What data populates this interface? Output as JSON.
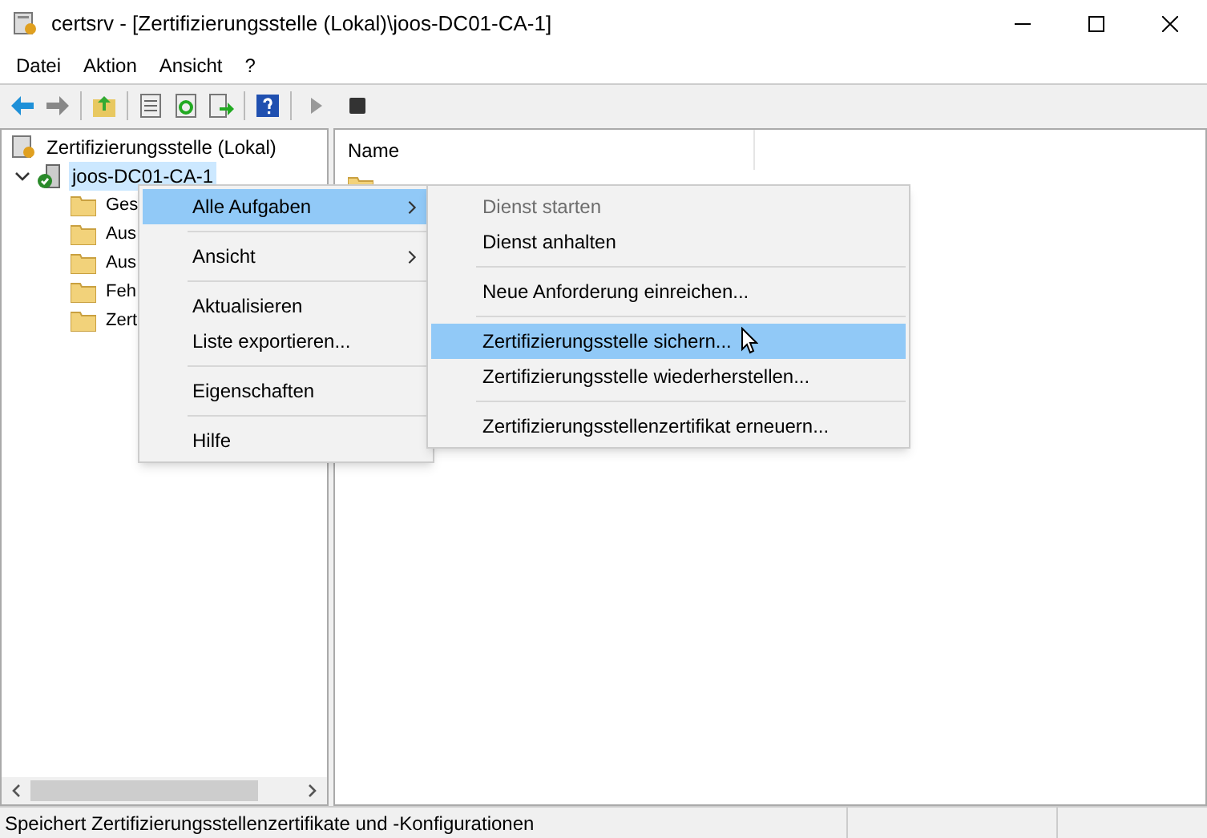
{
  "window": {
    "title": "certsrv - [Zertifizierungsstelle (Lokal)\\joos-DC01-CA-1]"
  },
  "menu_bar": [
    "Datei",
    "Aktion",
    "Ansicht",
    "?"
  ],
  "tree": [
    {
      "label": "Zertifizierungsstelle (Lokal)",
      "kind": "root",
      "selected": false,
      "children": [
        {
          "label": "joos-DC01-CA-1",
          "kind": "server",
          "selected": true,
          "expanded": true,
          "children": [
            {
              "label": "Ges",
              "kind": "folder",
              "selected": false
            },
            {
              "label": "Aus",
              "kind": "folder",
              "selected": false
            },
            {
              "label": "Aus",
              "kind": "folder",
              "selected": false
            },
            {
              "label": "Feh",
              "kind": "folder",
              "selected": false
            },
            {
              "label": "Zert",
              "kind": "folder",
              "selected": false
            }
          ]
        }
      ]
    }
  ],
  "list": {
    "columns": [
      "Name"
    ]
  },
  "context_menu": [
    {
      "kind": "item",
      "label": "Alle Aufgaben",
      "submenu": true,
      "selected": true
    },
    {
      "kind": "separator"
    },
    {
      "kind": "item",
      "label": "Ansicht",
      "submenu": true,
      "selected": false
    },
    {
      "kind": "separator"
    },
    {
      "kind": "item",
      "label": "Aktualisieren",
      "submenu": false,
      "selected": false
    },
    {
      "kind": "item",
      "label": "Liste exportieren...",
      "submenu": false,
      "selected": false
    },
    {
      "kind": "separator"
    },
    {
      "kind": "item",
      "label": "Eigenschaften",
      "submenu": false,
      "selected": false
    },
    {
      "kind": "separator"
    },
    {
      "kind": "item",
      "label": "Hilfe",
      "submenu": false,
      "selected": false
    }
  ],
  "submenu": [
    {
      "kind": "item",
      "label": "Dienst starten",
      "disabled": true,
      "selected": false
    },
    {
      "kind": "item",
      "label": "Dienst anhalten",
      "disabled": false,
      "selected": false
    },
    {
      "kind": "separator"
    },
    {
      "kind": "item",
      "label": "Neue Anforderung einreichen...",
      "disabled": false,
      "selected": false
    },
    {
      "kind": "separator"
    },
    {
      "kind": "item",
      "label": "Zertifizierungsstelle sichern...",
      "disabled": false,
      "selected": true
    },
    {
      "kind": "item",
      "label": "Zertifizierungsstelle wiederherstellen...",
      "disabled": false,
      "selected": false
    },
    {
      "kind": "separator"
    },
    {
      "kind": "item",
      "label": "Zertifizierungsstellenzertifikat erneuern...",
      "disabled": false,
      "selected": false
    }
  ],
  "status_bar": {
    "text": "Speichert Zertifizierungsstellenzertifikate und -Konfigurationen"
  }
}
